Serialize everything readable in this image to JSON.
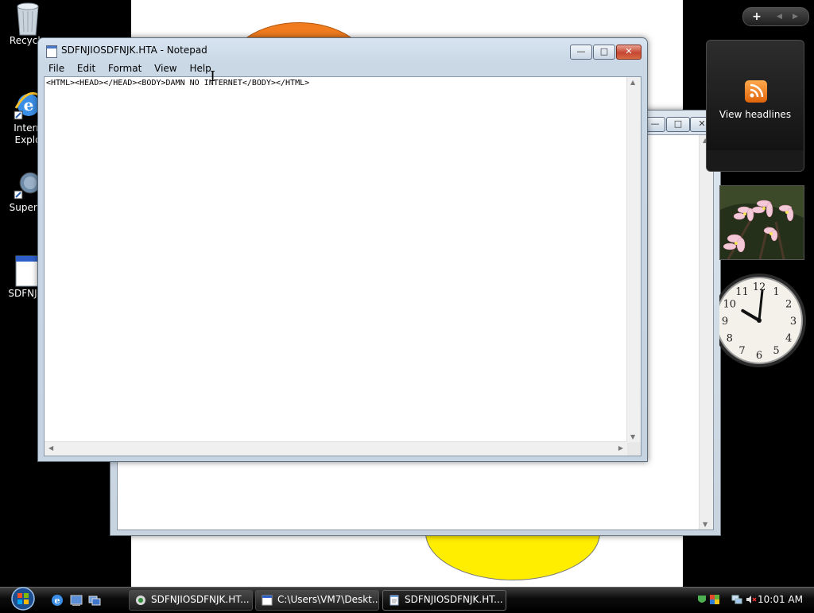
{
  "desktop": {
    "icons": [
      {
        "label": "Recycle"
      },
      {
        "label": "Intern Explo"
      },
      {
        "label": "Superm"
      },
      {
        "label": "SDFNJIO"
      }
    ]
  },
  "notepad": {
    "title": "SDFNJIOSDFNJK.HTA - Notepad",
    "menu": [
      "File",
      "Edit",
      "Format",
      "View",
      "Help"
    ],
    "content": "<HTML><HEAD></HEAD><BODY>DAMN NO INTERNET</BODY></HTML>"
  },
  "sidebar": {
    "feed_label": "View headlines",
    "clock": {
      "hours": 10,
      "minutes": 1
    }
  },
  "taskbar": {
    "tasks": [
      {
        "label": "SDFNJIOSDFNJK.HT..."
      },
      {
        "label": "C:\\Users\\VM7\\Deskt..."
      },
      {
        "label": "SDFNJIOSDFNJK.HT..."
      }
    ],
    "time": "10:01 AM"
  },
  "colors": {
    "orange_circle": "#f07c1e",
    "yellow_circle": "#ffee00",
    "close_button": "#c64632"
  }
}
